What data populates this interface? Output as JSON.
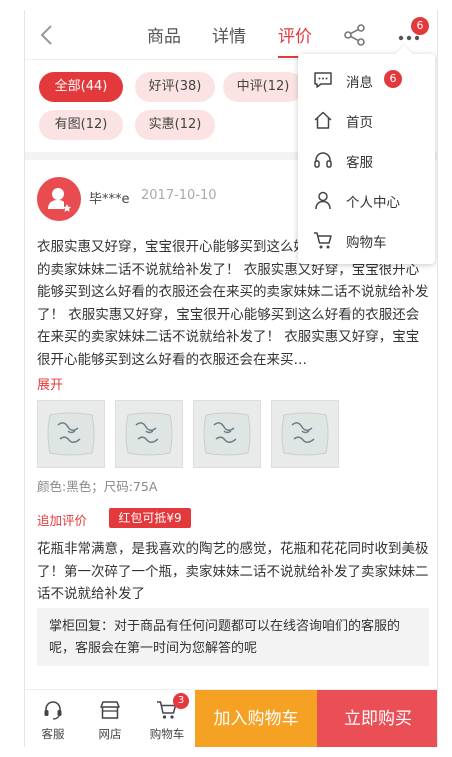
{
  "header": {
    "tabs": [
      {
        "label": "商品"
      },
      {
        "label": "详情"
      },
      {
        "label": "评价"
      }
    ],
    "active_tab": "评价",
    "more_badge": "6",
    "icons": [
      "back-icon",
      "share-icon",
      "more-icon"
    ]
  },
  "filters": [
    {
      "label": "全部(44)",
      "active": true
    },
    {
      "label": "好评(38)",
      "active": false
    },
    {
      "label": "中评(12)",
      "active": false
    },
    {
      "label": "有图(12)",
      "active": false
    },
    {
      "label": "实惠(12)",
      "active": false
    }
  ],
  "review": {
    "username": "毕***e",
    "date": "2017-10-10",
    "text": "衣服实惠又好穿，宝宝很开心能够买到这么好看的衣服还会在来买的卖家妹妹二话不说就给补发了！ 衣服实惠又好穿，宝宝很开心能够买到这么好看的衣服还会在来买的卖家妹妹二话不说就给补发了！ 衣服实惠又好穿，宝宝很开心能够买到这么好看的衣服还会在来买的卖家妹妹二话不说就给补发了！ 衣服实惠又好穿，宝宝很开心能够买到这么好看的衣服还会在来买…",
    "expand_label": "展开",
    "spec": "颜色:黑色；尺码:75A",
    "append_label": "追加评价",
    "red_packet": "红包可抵¥9",
    "append_text": "花瓶非常满意，是我喜欢的陶艺的感觉，花瓶和花花同时收到美极了！第一次碎了一个瓶，卖家妹妹二话不说就给补发了卖家妹妹二话不说就给补发了",
    "reply": "掌柜回复：对于商品有任何问题都可以在线咨询咱们的客服的呢，客服会在第一时间为您解答的呢"
  },
  "menu": {
    "items": [
      {
        "label": "消息",
        "icon": "message-icon",
        "badge": "6"
      },
      {
        "label": "首页",
        "icon": "home-icon"
      },
      {
        "label": "客服",
        "icon": "headset-icon"
      },
      {
        "label": "个人中心",
        "icon": "user-icon"
      },
      {
        "label": "购物车",
        "icon": "cart-icon"
      }
    ]
  },
  "bottom": {
    "service": "客服",
    "shop": "网店",
    "cart": "购物车",
    "cart_badge": "3",
    "add_to_cart": "加入购物车",
    "buy_now": "立即购买"
  },
  "colors": {
    "accent": "#e4393c",
    "chip_bg": "#fbe3e3",
    "cart_button": "#f4a124",
    "buy_button": "#ea4f55"
  }
}
